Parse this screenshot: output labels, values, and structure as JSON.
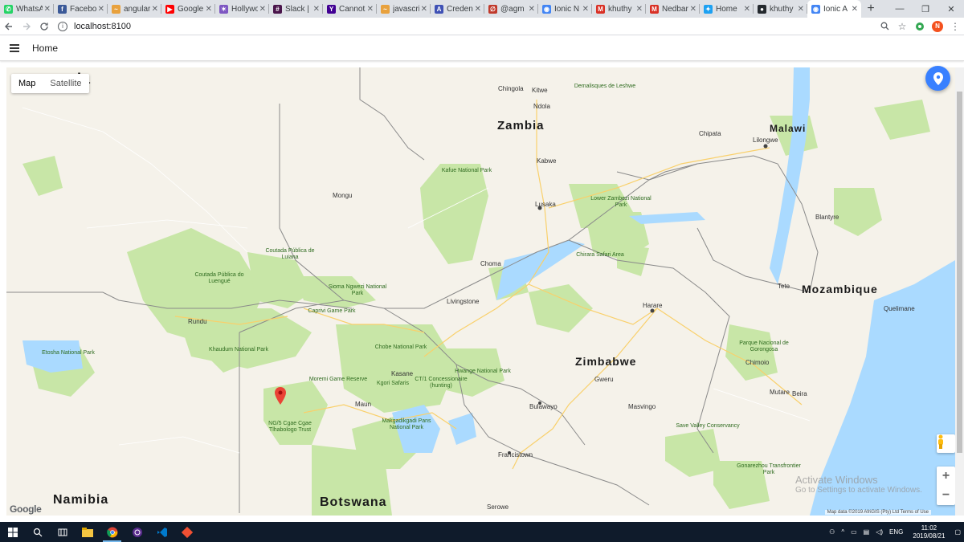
{
  "browser": {
    "tabs": [
      {
        "title": "WhatsA",
        "color": "#25d366",
        "glyph": "✆"
      },
      {
        "title": "Facebo",
        "color": "#3b5998",
        "glyph": "f"
      },
      {
        "title": "angular",
        "color": "#e8a13d",
        "glyph": "~"
      },
      {
        "title": "Google",
        "color": "#ff0000",
        "glyph": "▶"
      },
      {
        "title": "Hollywo",
        "color": "#7e57c2",
        "glyph": "✶"
      },
      {
        "title": "Slack |",
        "color": "#4a154b",
        "glyph": "#"
      },
      {
        "title": "Cannot",
        "color": "#410093",
        "glyph": "Y"
      },
      {
        "title": "javascri",
        "color": "#e8a13d",
        "glyph": "~"
      },
      {
        "title": "Creden",
        "color": "#3f51b5",
        "glyph": "A"
      },
      {
        "title": "@agm",
        "color": "#c0392b",
        "glyph": "∅"
      },
      {
        "title": "Ionic N",
        "color": "#4285f4",
        "glyph": "◉"
      },
      {
        "title": "khuthy",
        "color": "#d93025",
        "glyph": "M"
      },
      {
        "title": "Nedbar",
        "color": "#d93025",
        "glyph": "M"
      },
      {
        "title": "Home",
        "color": "#1da1f2",
        "glyph": "✦"
      },
      {
        "title": "khuthy",
        "color": "#24292e",
        "glyph": "●"
      },
      {
        "title": "Ionic A",
        "color": "#4285f4",
        "glyph": "◉",
        "active": true
      }
    ],
    "new_tab": "+",
    "window_controls": [
      "—",
      "❐",
      "✕"
    ],
    "url": "localhost:8100",
    "profile_initial": "N"
  },
  "app": {
    "title": "Home"
  },
  "map": {
    "type_options": [
      "Map",
      "Satellite"
    ],
    "selected_type": "Map",
    "zoom_in": "+",
    "zoom_out": "−",
    "logo": "Google",
    "attribution": "Map data ©2019 AfriGIS (Pty) Ltd   Terms of Use",
    "countries": [
      "ngola",
      "Zambia",
      "Malawi",
      "Mozambique",
      "Zimbabwe",
      "Namibia",
      "Botswana"
    ],
    "cities": [
      "Lusaka",
      "Lilongwe",
      "Harare",
      "Bulawayo",
      "Francistown",
      "Kabwe",
      "Blantyre",
      "Chipata",
      "Livingstone",
      "Maun",
      "Gweru",
      "Kitwe",
      "Ndola",
      "Chingola",
      "Mongu",
      "Choma",
      "Mutare",
      "Beira",
      "Chimoio",
      "Tete",
      "Quelimane",
      "Kasane",
      "Rundu",
      "Masvingo",
      "Serowe"
    ],
    "parks": [
      "Kafue National Park",
      "Lower Zambezi National Park",
      "Chobe National Park",
      "Hwange National Park",
      "Moremi Game Reserve",
      "Khaudum National Park",
      "Makgadikgadi Pans National Park",
      "Coutada Pública do Luengué",
      "Coutada Pública de Luiana",
      "Sioma Ngwezi National Park",
      "Save Valley Conservancy",
      "Parque Nacional de Gorongosa",
      "Gonarezhou Transfrontier Park",
      "Chirara Safari Area",
      "CT/1 Concessionaire (hunting)",
      "Kgori Safaris",
      "NG/5 Cgae Cgae Tlhabologo Trust",
      "Etosha National Park",
      "Caprivi Game Park",
      "Demalisques de Leshwe"
    ]
  },
  "overlay": {
    "activate_title": "Activate Windows",
    "activate_sub": "Go to Settings to activate Windows."
  },
  "taskbar": {
    "language": "ENG",
    "time": "11:02",
    "date": "2019/08/21"
  },
  "colors": {
    "fab": "#3880ff",
    "marker": "#ea4335",
    "water": "#aadaff",
    "park": "#c8e6a7"
  }
}
